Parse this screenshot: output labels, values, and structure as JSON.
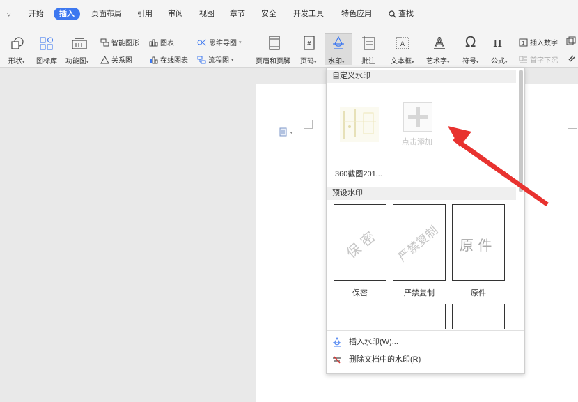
{
  "menubar": {
    "items": [
      {
        "label": "开始"
      },
      {
        "label": "插入",
        "active": true
      },
      {
        "label": "页面布局"
      },
      {
        "label": "引用"
      },
      {
        "label": "审阅"
      },
      {
        "label": "视图"
      },
      {
        "label": "章节"
      },
      {
        "label": "安全"
      },
      {
        "label": "开发工具"
      },
      {
        "label": "特色应用"
      },
      {
        "label": "查找"
      }
    ]
  },
  "ribbon": {
    "shape": "形状",
    "icon_lib": "图标库",
    "func_chart": "功能图",
    "smart_shape": "智能图形",
    "chart": "图表",
    "mind_map": "思维导图",
    "relation": "关系图",
    "online_chart": "在线图表",
    "flow_chart": "流程图",
    "header_footer": "页眉和页脚",
    "page_num": "页码",
    "watermark": "水印",
    "comment": "批注",
    "text_box": "文本框",
    "art_text": "艺术字",
    "symbol": "符号",
    "formula": "公式",
    "insert_number": "插入数字",
    "drop_cap": "首字下沉"
  },
  "dropdown": {
    "custom_header": "自定义水印",
    "custom_item_label": "360截图201...",
    "add_label": "点击添加",
    "preset_header": "预设水印",
    "presets": [
      {
        "label": "保密",
        "text": "保 密"
      },
      {
        "label": "严禁复制",
        "text": "严禁复制"
      },
      {
        "label": "原件",
        "text": "原 件"
      }
    ],
    "insert_action": "插入水印(W)...",
    "delete_action": "删除文档中的水印(R)"
  },
  "colors": {
    "accent": "#3d78f0",
    "annotation_arrow": "#e8322f"
  }
}
